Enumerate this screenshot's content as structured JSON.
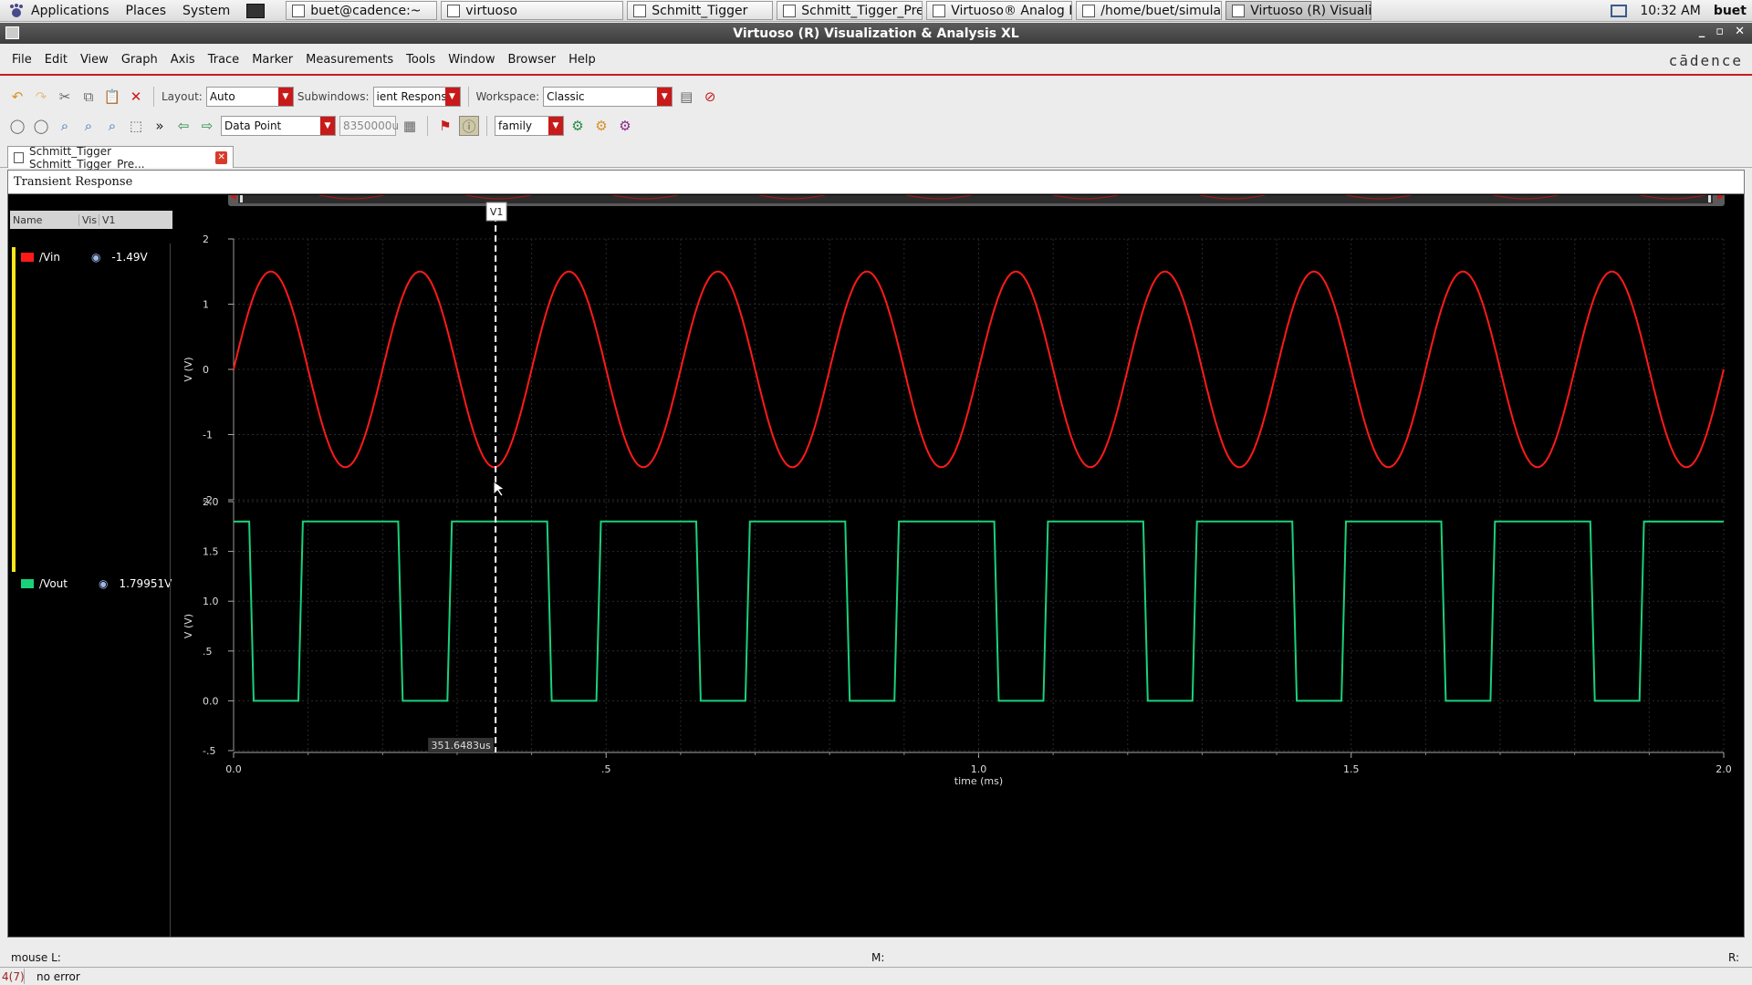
{
  "panel": {
    "menus": [
      "Applications",
      "Places",
      "System"
    ],
    "tasks": [
      {
        "label": "buet@cadence:~",
        "active": false
      },
      {
        "label": "virtuoso",
        "active": false
      },
      {
        "label": "Schmitt_Tigger",
        "active": false
      },
      {
        "label": "Schmitt_Tigger_Pre_la...",
        "active": false
      },
      {
        "label": "Virtuoso® Analog Des...",
        "active": false
      },
      {
        "label": "/home/buet/simulation...",
        "active": false
      },
      {
        "label": "Virtuoso (R) Visualizati...",
        "active": true
      }
    ],
    "clock": "10:32 AM",
    "user": "buet"
  },
  "window": {
    "title": "Virtuoso (R) Visualization & Analysis XL",
    "controls": [
      "_",
      "▫",
      "✕"
    ],
    "brand": "cādence"
  },
  "menubar": [
    "File",
    "Edit",
    "View",
    "Graph",
    "Axis",
    "Trace",
    "Marker",
    "Measurements",
    "Tools",
    "Window",
    "Browser",
    "Help"
  ],
  "toolbar1": {
    "layout_label": "Layout:",
    "layout_value": "Auto",
    "subwindows_label": "Subwindows:",
    "subwindows_value": "ient Response",
    "workspace_label": "Workspace:",
    "workspace_value": "Classic"
  },
  "toolbar2": {
    "overflow": "»",
    "snap_mode": "Data Point",
    "x_value": "8350000u",
    "family_value": "family"
  },
  "tab": {
    "label": "Schmitt_Tigger Schmitt_Tigger_Pre..."
  },
  "subwindow_title": "Transient Response",
  "legend": {
    "headers": [
      "Name",
      "Vis",
      "V1"
    ],
    "traces": [
      {
        "name": "/Vin",
        "value": "-1.49V",
        "color": "#ff1a1a"
      },
      {
        "name": "/Vout",
        "value": "1.79951V",
        "color": "#1ad17a"
      }
    ]
  },
  "marker": {
    "label": "V1",
    "readout": "351.6483us",
    "time_ms": 0.3516483
  },
  "colors": {
    "vin": "#ff1a1a",
    "vout": "#1ad17a",
    "grid": "#2a2a2a",
    "accent": "#c81a1a"
  },
  "chart_data": [
    {
      "type": "line",
      "title": "",
      "xlabel": "time (ms)",
      "ylabel": "V (V)",
      "xlim": [
        0,
        2.0
      ],
      "ylim": [
        -2,
        2
      ],
      "y_ticks": [
        "2",
        "1",
        "0",
        "-1",
        "-2"
      ],
      "series": [
        {
          "name": "/Vin",
          "shape": "sine",
          "amplitude": 1.5,
          "offset": 0,
          "frequency_khz": 5,
          "color": "#ff1a1a"
        }
      ]
    },
    {
      "type": "line",
      "title": "",
      "xlabel": "time (ms)",
      "ylabel": "V (V)",
      "xlim": [
        0,
        2.0
      ],
      "ylim": [
        -0.5,
        2.0
      ],
      "y_ticks": [
        "2.0",
        "1.5",
        "1.0",
        ".5",
        "0.0",
        "-.5"
      ],
      "x_ticks": [
        "0.0",
        ".5",
        "1.0",
        "1.5",
        "2.0"
      ],
      "series": [
        {
          "name": "/Vout",
          "shape": "square",
          "high": 1.8,
          "low": 0.0,
          "color": "#1ad17a",
          "transitions": [
            {
              "t": 0.021,
              "v": 0.0
            },
            {
              "t": 0.087,
              "v": 1.8
            },
            {
              "t": 0.221,
              "v": 0.0
            },
            {
              "t": 0.287,
              "v": 1.8
            },
            {
              "t": 0.421,
              "v": 0.0
            },
            {
              "t": 0.487,
              "v": 1.8
            },
            {
              "t": 0.621,
              "v": 0.0
            },
            {
              "t": 0.687,
              "v": 1.8
            },
            {
              "t": 0.821,
              "v": 0.0
            },
            {
              "t": 0.887,
              "v": 1.8
            },
            {
              "t": 1.021,
              "v": 0.0
            },
            {
              "t": 1.087,
              "v": 1.8
            },
            {
              "t": 1.221,
              "v": 0.0
            },
            {
              "t": 1.287,
              "v": 1.8
            },
            {
              "t": 1.421,
              "v": 0.0
            },
            {
              "t": 1.487,
              "v": 1.8
            },
            {
              "t": 1.621,
              "v": 0.0
            },
            {
              "t": 1.687,
              "v": 1.8
            },
            {
              "t": 1.821,
              "v": 0.0
            },
            {
              "t": 1.887,
              "v": 1.8
            }
          ]
        }
      ]
    }
  ],
  "status": {
    "mouse_l": "mouse L:",
    "mouse_m": "M:",
    "mouse_r": "R:",
    "counter": "4(7)",
    "message": "no error"
  }
}
